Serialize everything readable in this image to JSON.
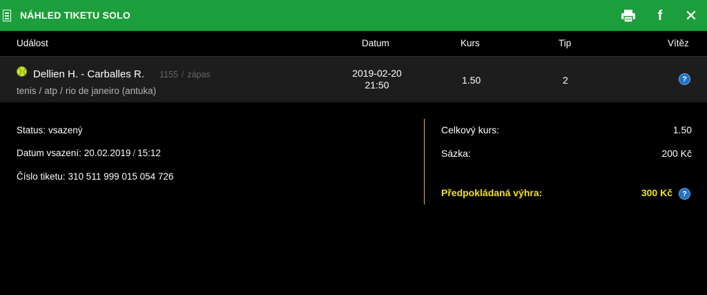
{
  "header": {
    "title": "NÁHLED TIKETU SOLO",
    "icons": [
      "ticket-icon",
      "print-icon",
      "facebook-icon",
      "close-icon"
    ],
    "facebook_glyph": "f",
    "close_glyph": "✕",
    "background": "#1c9e3c"
  },
  "columns": {
    "event": "Událost",
    "date": "Datum",
    "odds": "Kurs",
    "tip": "Tip",
    "winner": "Vítěz"
  },
  "event": {
    "match": "Dellien H. - Carballes R.",
    "number": "1155",
    "type": "zápas",
    "sport": "tenis",
    "league": "atp",
    "tournament": "rio de janeiro (antuka)",
    "date": "2019-02-20",
    "time": "21:50",
    "odds": "1.50",
    "tip": "2",
    "winner_glyph": "?"
  },
  "info": {
    "status_label": "Status:",
    "status_value": "vsazený",
    "bet_date_label": "Datum vsazení:",
    "bet_date": "20.02.2019",
    "bet_time": "15:12",
    "ticket_label": "Číslo tiketu:",
    "ticket_value": "310 511 999 015 054 726"
  },
  "summary": {
    "total_odds_label": "Celkový kurs:",
    "total_odds_value": "1.50",
    "stake_label": "Sázka:",
    "stake_value": "200 Kč",
    "win_label": "Předpokládaná výhra:",
    "win_value": "300 Kč",
    "help_glyph": "?",
    "highlight_color": "#f2e21c"
  },
  "separators": {
    "slash": "/"
  }
}
